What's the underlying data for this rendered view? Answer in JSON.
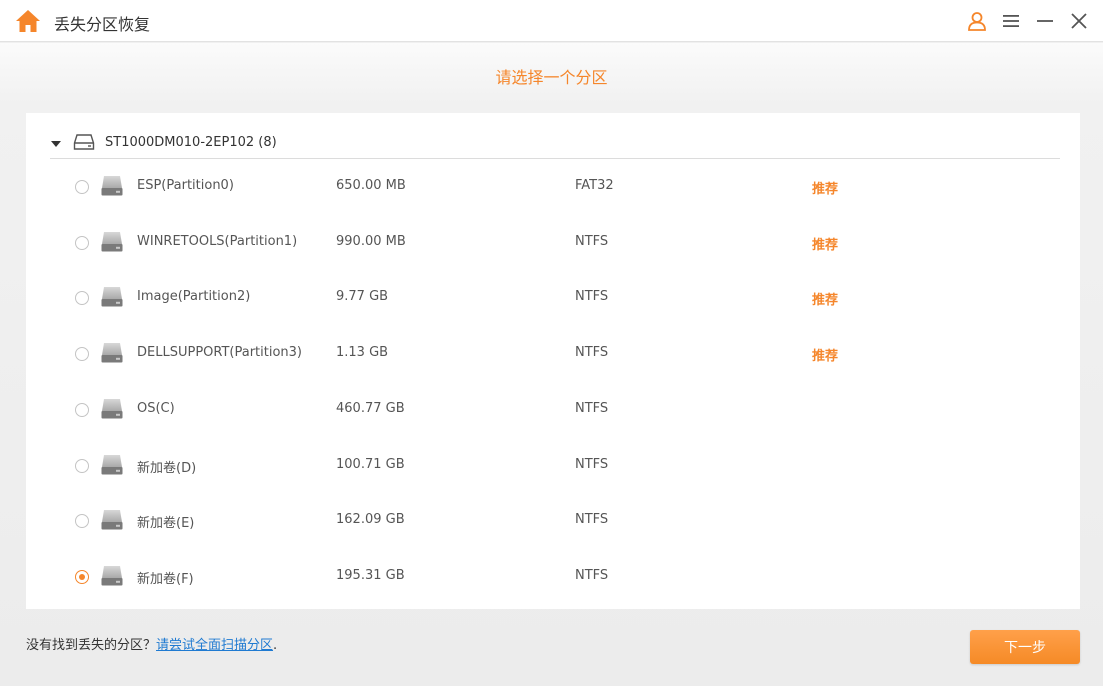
{
  "app": {
    "title": "丢失分区恢复"
  },
  "colors": {
    "accent": "#f5862b",
    "link": "#1f7ad1"
  },
  "heading": "请选择一个分区",
  "disk": {
    "label": "ST1000DM010-2EP102 (8)",
    "expanded": true
  },
  "partitions": [
    {
      "name": "ESP(Partition0)",
      "size": "650.00 MB",
      "fs": "FAT32",
      "recommend": "推荐",
      "selected": false
    },
    {
      "name": "WINRETOOLS(Partition1)",
      "size": "990.00 MB",
      "fs": "NTFS",
      "recommend": "推荐",
      "selected": false
    },
    {
      "name": "Image(Partition2)",
      "size": "9.77 GB",
      "fs": "NTFS",
      "recommend": "推荐",
      "selected": false
    },
    {
      "name": "DELLSUPPORT(Partition3)",
      "size": "1.13 GB",
      "fs": "NTFS",
      "recommend": "推荐",
      "selected": false
    },
    {
      "name": "OS(C)",
      "size": "460.77 GB",
      "fs": "NTFS",
      "recommend": "",
      "selected": false
    },
    {
      "name": "新加卷(D)",
      "size": "100.71 GB",
      "fs": "NTFS",
      "recommend": "",
      "selected": false
    },
    {
      "name": "新加卷(E)",
      "size": "162.09 GB",
      "fs": "NTFS",
      "recommend": "",
      "selected": false
    },
    {
      "name": "新加卷(F)",
      "size": "195.31 GB",
      "fs": "NTFS",
      "recommend": "",
      "selected": true
    }
  ],
  "footer": {
    "prompt": "没有找到丢失的分区？",
    "link": "请尝试全面扫描分区",
    "suffix": "."
  },
  "next_button": "下一步"
}
